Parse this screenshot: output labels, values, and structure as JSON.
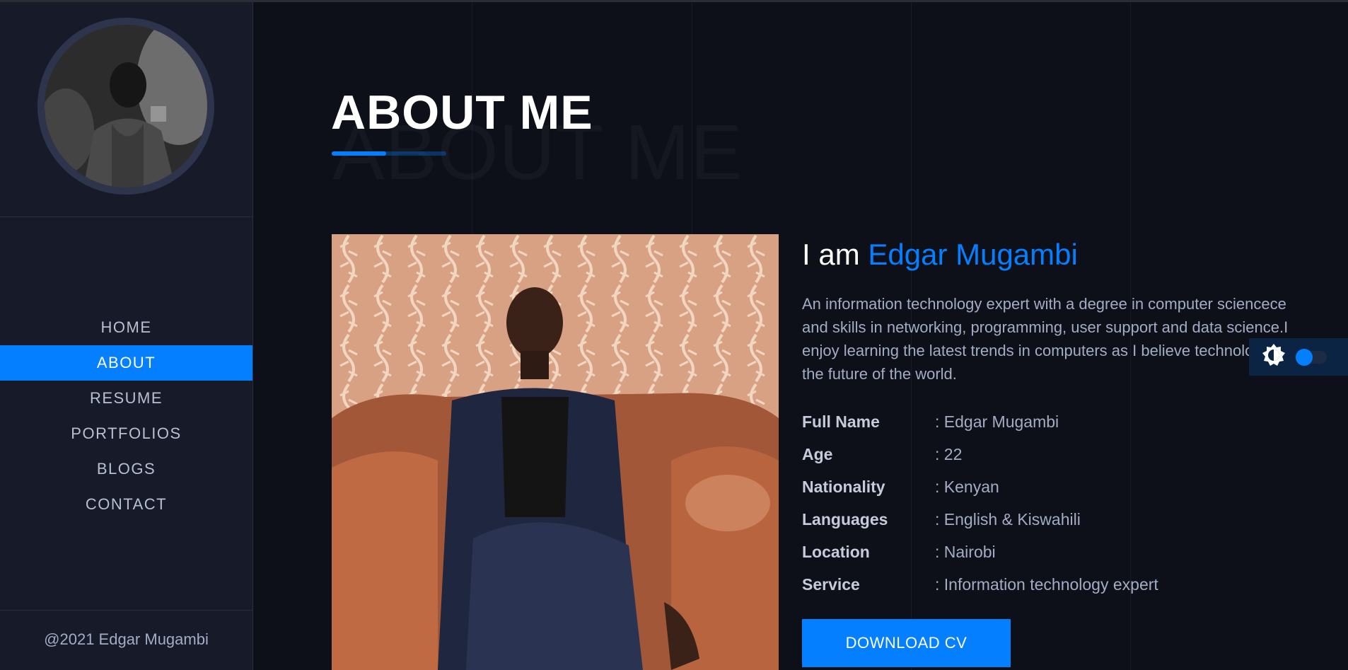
{
  "sidebar": {
    "nav": [
      "HOME",
      "ABOUT",
      "RESUME",
      "PORTFOLIOS",
      "BLOGS",
      "CONTACT"
    ],
    "active": "ABOUT",
    "copyright": "@2021 Edgar Mugambi"
  },
  "section": {
    "title": "ABOUT ME",
    "title_bg": "ABOUT ME"
  },
  "about": {
    "intro_prefix": "I am",
    "intro_name": "Edgar Mugambi",
    "bio": "An information technology expert with a degree in computer sciencece and skills in networking, programming, user support and data science.I enjoy learning the latest trends in computers as I believe technology is the future of the world.",
    "details": [
      {
        "label": "Full Name",
        "value": ": Edgar Mugambi"
      },
      {
        "label": "Age",
        "value": ": 22"
      },
      {
        "label": "Nationality",
        "value": ": Kenyan"
      },
      {
        "label": "Languages",
        "value": ": English & Kiswahili"
      },
      {
        "label": "Location",
        "value": ": Nairobi"
      },
      {
        "label": "Service",
        "value": ": Information technology expert"
      }
    ],
    "download_label": "DOWNLOAD CV"
  },
  "theme": {
    "icon": "brightness-icon",
    "mode": "dark"
  },
  "colors": {
    "accent": "#037fff",
    "background": "#0e1019",
    "sidebar": "#171b29"
  }
}
